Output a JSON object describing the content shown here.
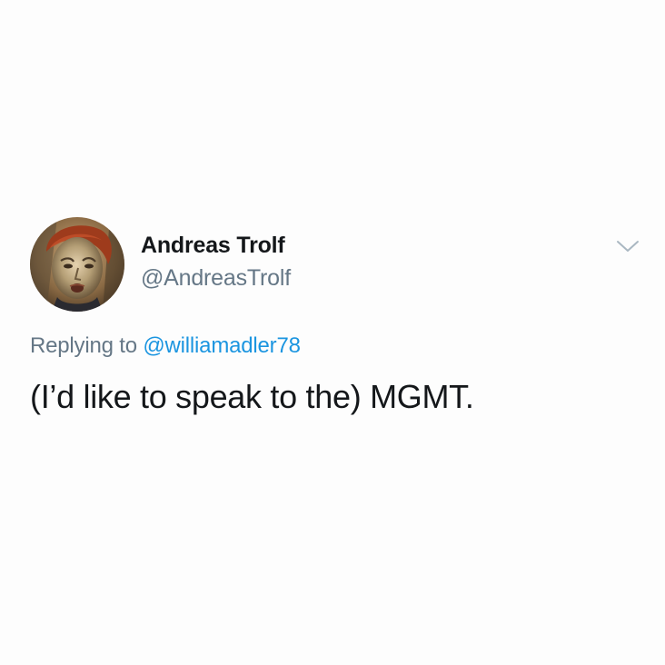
{
  "user": {
    "display_name": "Andreas Trolf",
    "handle": "@AndreasTrolf",
    "avatar_icon": "avatar-portrait"
  },
  "reply": {
    "prefix": "Replying to",
    "mention": "@williamadler78"
  },
  "tweet": {
    "text": "(I’d like to speak to the) MGMT."
  },
  "menu": {
    "icon": "chevron-down-icon"
  },
  "colors": {
    "background": "#fdfdfd",
    "primary_text": "#14171a",
    "secondary_text": "#657786",
    "link": "#1b95e0",
    "chevron": "#aab8c2"
  }
}
